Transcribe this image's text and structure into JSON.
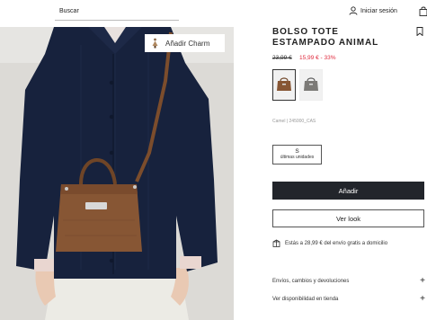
{
  "header": {
    "search_label": "Buscar",
    "login_label": "Iniciar sesión",
    "user_icon": "user-icon",
    "cart_icon": "bag-icon"
  },
  "image": {
    "charm_label": "Añadir Charm",
    "charm_icon": "charm-icon"
  },
  "product": {
    "title": "BOLSO TOTE ESTAMPADO ANIMAL",
    "old_price": "23,99 €",
    "new_price": "15,99 € - 33%",
    "reference": "Camel  |  245000_CAS",
    "bookmark_icon": "bookmark-icon",
    "colors": [
      "Camel",
      "Gris"
    ],
    "size": {
      "label": "S",
      "note": "últimas unidades"
    },
    "add_button": "Añadir",
    "look_button": "Ver look",
    "shipping_text": "Estás a 28,99 € del envío gratis a domicilio",
    "accordion": [
      {
        "label": "Envíos, cambios y devoluciones"
      },
      {
        "label": "Ver disponibilidad en tienda"
      }
    ]
  },
  "colors": {
    "sale": "#e02a3d",
    "button_dark": "#22252b",
    "sweater": "#17223d",
    "bag": "#875634"
  }
}
